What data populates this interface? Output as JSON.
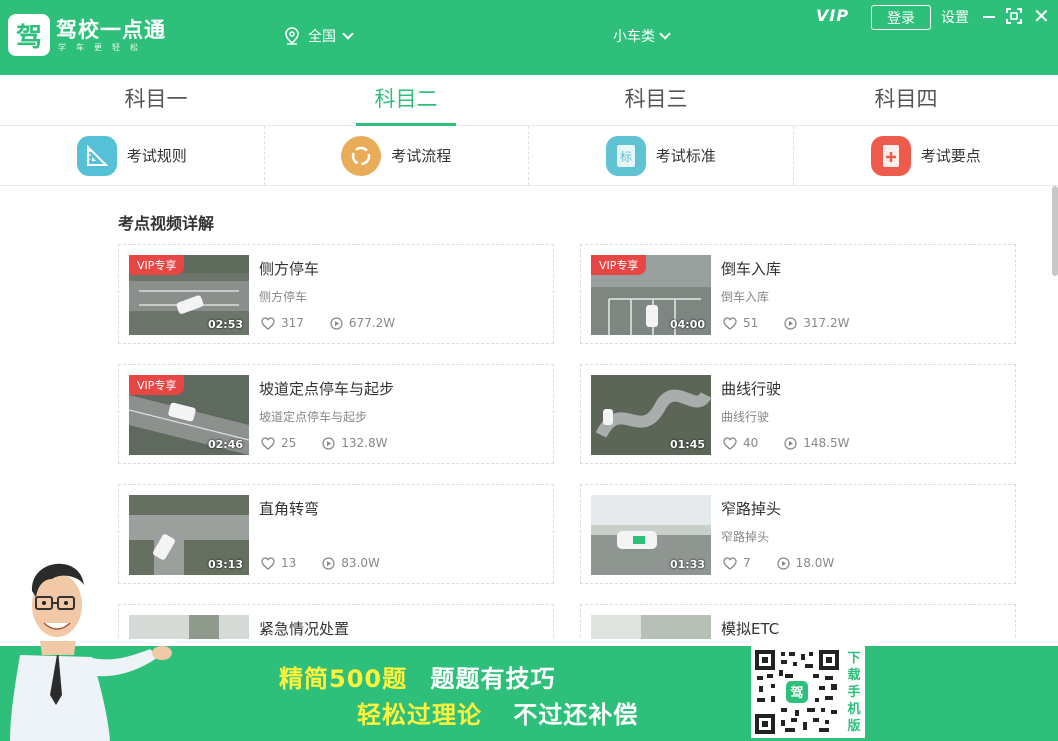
{
  "app": {
    "logo_glyph": "驾",
    "name": "驾校一点通",
    "slogan": "学车更轻松",
    "region": "全国",
    "car_type": "小车类",
    "vip": "VIP",
    "login": "登录",
    "settings": "设置",
    "brand_color": "#2ec07b"
  },
  "tabs": [
    {
      "label": "科目一"
    },
    {
      "label": "科目二"
    },
    {
      "label": "科目三"
    },
    {
      "label": "科目四"
    }
  ],
  "categories": [
    {
      "label": "考试规则",
      "icon": "ruler-icon",
      "color": "#55c0d6"
    },
    {
      "label": "考试流程",
      "icon": "flow-icon",
      "color": "#e9ad5a"
    },
    {
      "label": "考试标准",
      "icon": "standard-icon",
      "color": "#5fc3d3"
    },
    {
      "label": "考试要点",
      "icon": "key-points-icon",
      "color": "#ef5b4b"
    }
  ],
  "section_title": "考点视频详解",
  "vip_badge": "VIP专享",
  "videos": [
    {
      "title": "侧方停车",
      "sub": "侧方停车",
      "likes": "317",
      "plays": "677.2W",
      "duration": "02:53",
      "vip": true
    },
    {
      "title": "倒车入库",
      "sub": "倒车入库",
      "likes": "51",
      "plays": "317.2W",
      "duration": "04:00",
      "vip": true
    },
    {
      "title": "坡道定点停车与起步",
      "sub": "坡道定点停车与起步",
      "likes": "25",
      "plays": "132.8W",
      "duration": "02:46",
      "vip": true
    },
    {
      "title": "曲线行驶",
      "sub": "曲线行驶",
      "likes": "40",
      "plays": "148.5W",
      "duration": "01:45",
      "vip": false
    },
    {
      "title": "直角转弯",
      "sub": "",
      "likes": "13",
      "plays": "83.0W",
      "duration": "03:13",
      "vip": false
    },
    {
      "title": "窄路掉头",
      "sub": "窄路掉头",
      "likes": "7",
      "plays": "18.0W",
      "duration": "01:33",
      "vip": false
    },
    {
      "title": "紧急情况处置",
      "sub": "",
      "likes": "",
      "plays": "",
      "duration": "",
      "vip": false
    },
    {
      "title": "模拟ETC",
      "sub": "",
      "likes": "",
      "plays": "",
      "duration": "",
      "vip": false
    }
  ],
  "banner": {
    "line1_a": "精简500题",
    "line1_b": "题题有技巧",
    "line2_a": "轻松过理论",
    "line2_b": "不过还补偿",
    "download": [
      "下",
      "载",
      "手",
      "机",
      "版"
    ]
  }
}
